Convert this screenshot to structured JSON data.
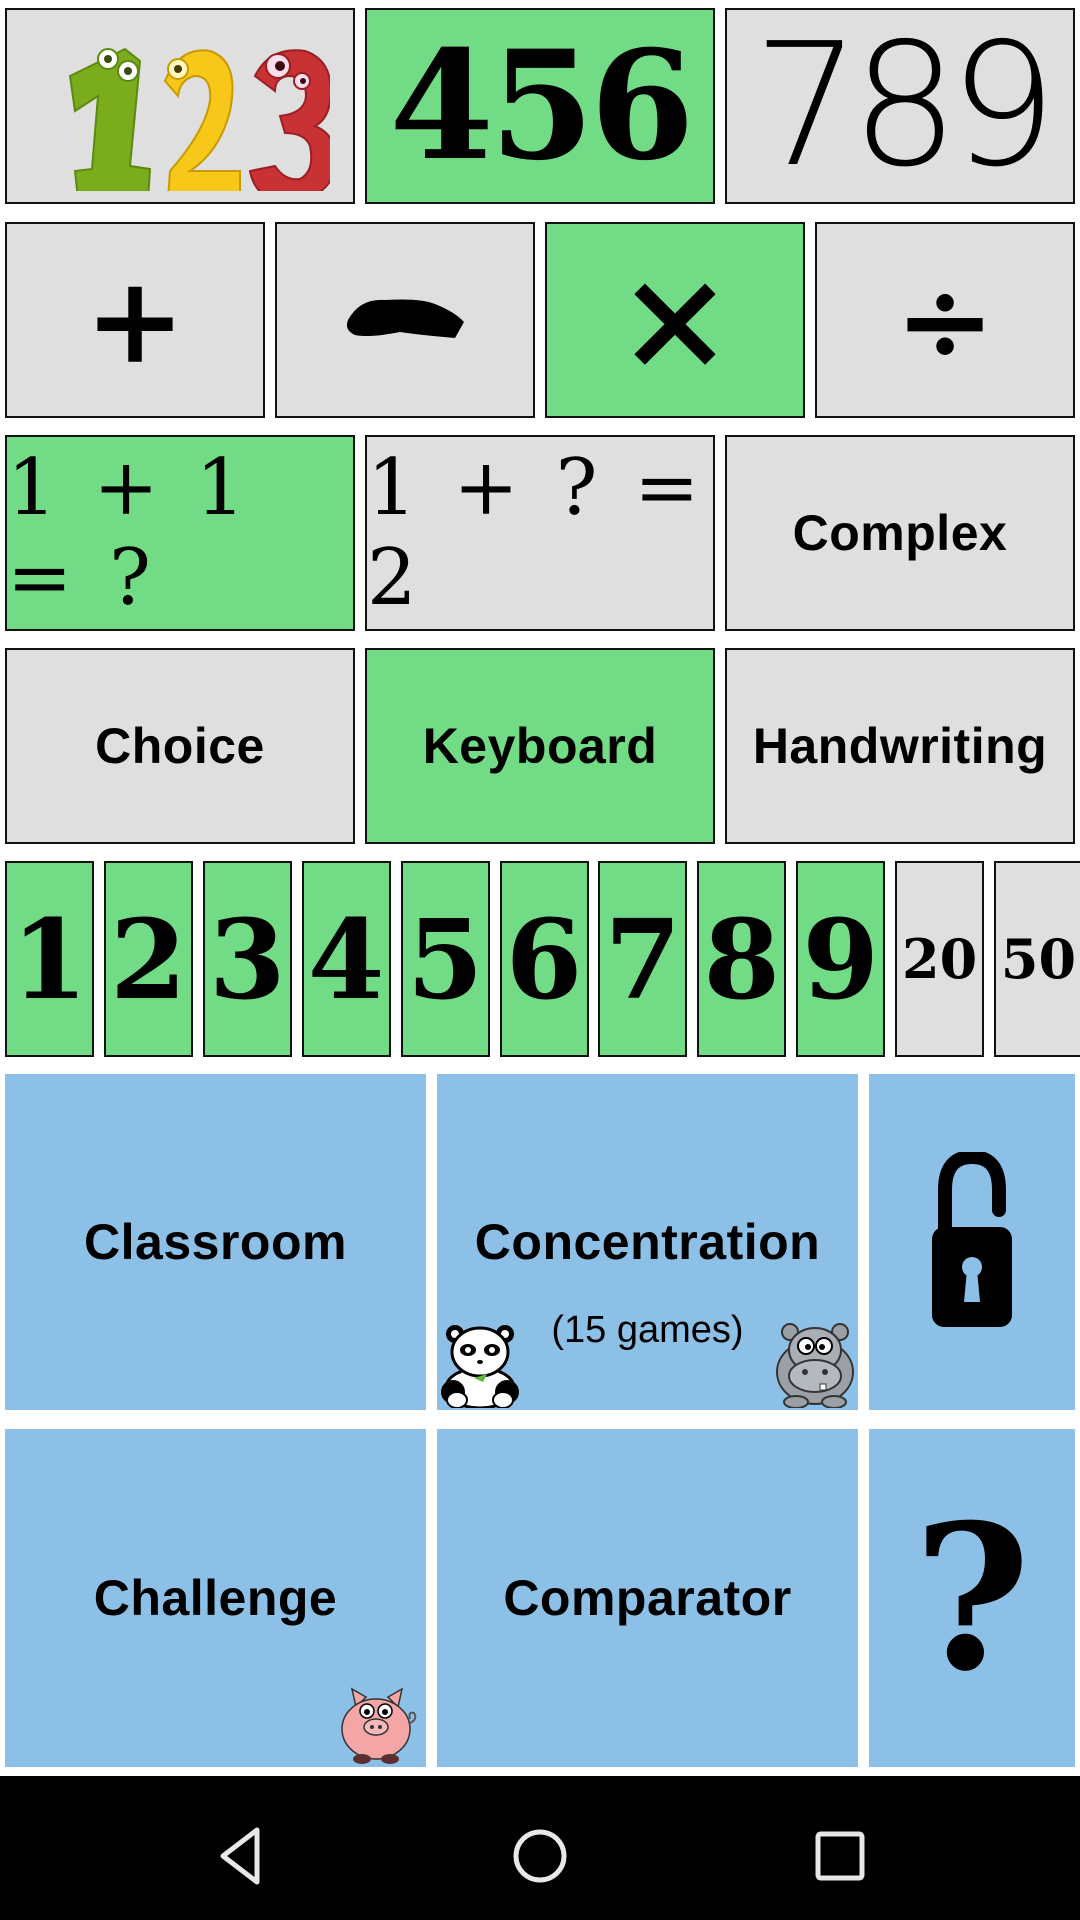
{
  "ranges": {
    "items": [
      {
        "label": "123",
        "style": "cartoon",
        "selected": false
      },
      {
        "label": "456",
        "style": "handwritten",
        "selected": true
      },
      {
        "label": "789",
        "style": "thin",
        "selected": false
      }
    ]
  },
  "operations": {
    "items": [
      {
        "label": "+",
        "name": "addition",
        "selected": false
      },
      {
        "label": "−",
        "name": "subtraction",
        "selected": false
      },
      {
        "label": "×",
        "name": "multiplication",
        "selected": true
      },
      {
        "label": "÷",
        "name": "division",
        "selected": false
      }
    ]
  },
  "question_types": {
    "items": [
      {
        "label": "1 + 1 = ?",
        "selected": true
      },
      {
        "label": "1 + ? = 2",
        "selected": false
      },
      {
        "label": "Complex",
        "selected": false
      }
    ]
  },
  "answer_modes": {
    "items": [
      {
        "label": "Choice",
        "selected": false
      },
      {
        "label": "Keyboard",
        "selected": true
      },
      {
        "label": "Handwriting",
        "selected": false
      }
    ]
  },
  "tables": {
    "items": [
      {
        "label": "1",
        "selected": true
      },
      {
        "label": "2",
        "selected": true
      },
      {
        "label": "3",
        "selected": true
      },
      {
        "label": "4",
        "selected": true
      },
      {
        "label": "5",
        "selected": true
      },
      {
        "label": "6",
        "selected": true
      },
      {
        "label": "7",
        "selected": true
      },
      {
        "label": "8",
        "selected": true
      },
      {
        "label": "9",
        "selected": true
      },
      {
        "label": "20",
        "selected": false
      },
      {
        "label": "50",
        "selected": false
      }
    ]
  },
  "games": {
    "classroom": "Classroom",
    "concentration": "Concentration",
    "concentration_sub": "(15 games)",
    "challenge": "Challenge",
    "comparator": "Comparator",
    "lock_icon": "unlocked-padlock",
    "help_icon": "question-mark"
  },
  "colors": {
    "selected": "#72db85",
    "unselected": "#dfdfdf",
    "game_tile": "#8cc0e7",
    "navbar": "#000000"
  },
  "navbar": {
    "back": "back",
    "home": "home",
    "recents": "recents"
  }
}
